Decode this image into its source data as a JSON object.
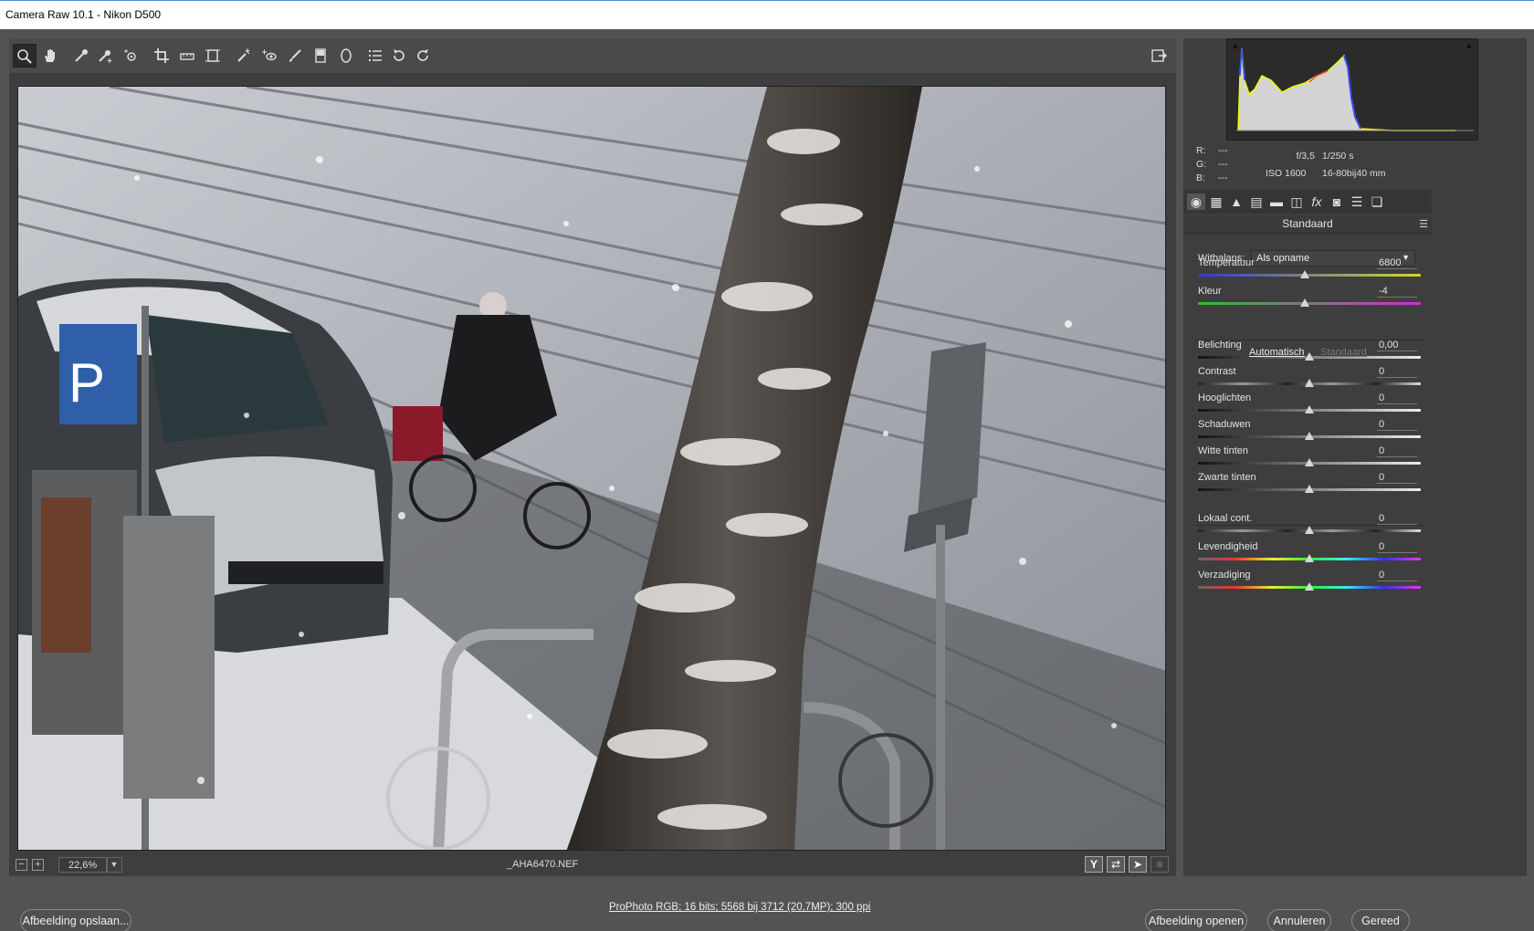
{
  "window": {
    "title": "Camera Raw 10.1  -  Nikon D500"
  },
  "toolbar": {
    "tools": [
      "zoom-tool",
      "hand-tool",
      "white-balance-tool",
      "color-sampler-tool",
      "targeted-adjustment-tool",
      "crop-tool",
      "straighten-tool",
      "transform-tool",
      "spot-removal-tool",
      "red-eye-tool",
      "adjustment-brush",
      "graduated-filter",
      "radial-filter",
      "open-preferences",
      "rotate-ccw",
      "rotate-cw"
    ],
    "fullscreen_icon": "toggle-fullscreen-icon"
  },
  "status": {
    "zoom_value": "22,6%",
    "filename": "_AHA6470.NEF"
  },
  "info": {
    "r_label": "R:",
    "g_label": "G:",
    "b_label": "B:",
    "r_value": "---",
    "g_value": "---",
    "b_value": "---",
    "aperture": "f/3,5",
    "shutter": "1/250 s",
    "iso": "ISO 1600",
    "lens": "16-80bij40 mm"
  },
  "panel": {
    "title": "Standaard",
    "tabs": [
      "basic-icon",
      "tone-curve-icon",
      "detail-icon",
      "hsl-icon",
      "split-toning-icon",
      "lens-corrections-icon",
      "effects-icon",
      "camera-calibration-icon",
      "presets-icon",
      "snapshots-icon"
    ],
    "wb_label": "Witbalans:",
    "wb_value": "Als opname",
    "auto_label": "Automatisch",
    "default_label": "Standaard",
    "sliders": [
      {
        "label": "Temperatuur",
        "value": "6800",
        "position": 0.48
      },
      {
        "label": "Kleur",
        "value": "-4",
        "position": 0.48
      },
      {
        "label": "Belichting",
        "value": "0,00",
        "position": 0.5
      },
      {
        "label": "Contrast",
        "value": "0",
        "position": 0.5
      },
      {
        "label": "Hooglichten",
        "value": "0",
        "position": 0.5
      },
      {
        "label": "Schaduwen",
        "value": "0",
        "position": 0.5
      },
      {
        "label": "Witte tinten",
        "value": "0",
        "position": 0.5
      },
      {
        "label": "Zwarte tinten",
        "value": "0",
        "position": 0.5
      },
      {
        "label": "Lokaal cont.",
        "value": "0",
        "position": 0.5
      },
      {
        "label": "Levendigheid",
        "value": "0",
        "position": 0.5
      },
      {
        "label": "Verzadiging",
        "value": "0",
        "position": 0.5
      }
    ]
  },
  "bottom": {
    "save_label": "Afbeelding opslaan...",
    "workflow_label": "ProPhoto RGB; 16 bits; 5568 bij 3712 (20,7MP); 300 ppi",
    "open_label": "Afbeelding openen",
    "cancel_label": "Annuleren",
    "done_label": "Gereed"
  }
}
